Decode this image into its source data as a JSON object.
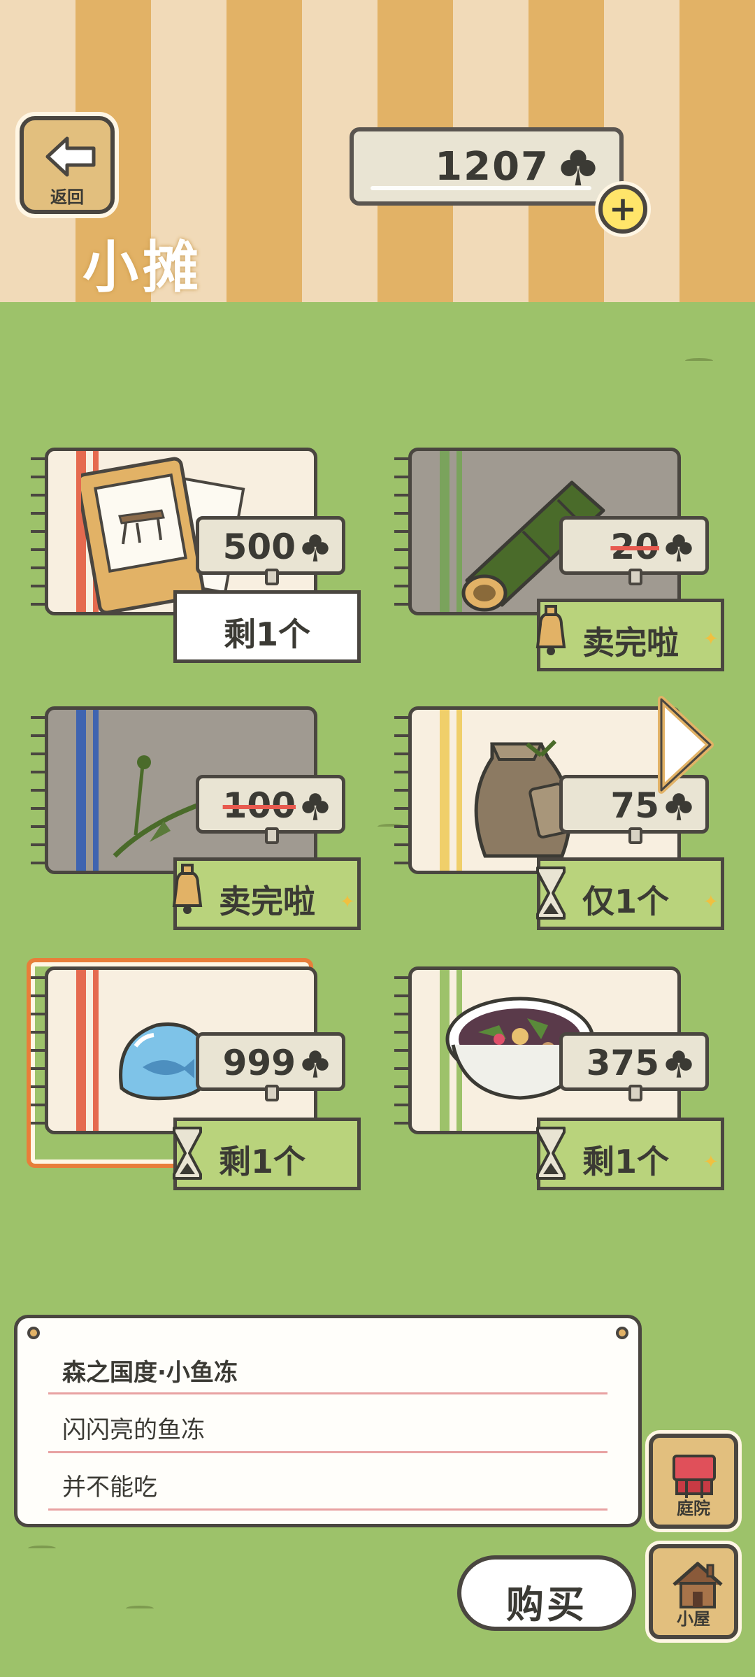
{
  "header": {
    "title": "小摊",
    "back_label": "返回",
    "currency_value": "1207",
    "currency_icon": "clover-icon",
    "plus_icon": "plus-icon"
  },
  "items": [
    {
      "name": "chair-poster",
      "price": "500",
      "price_struck": false,
      "status": "剩1个",
      "status_style": "white",
      "status_icon": ""
    },
    {
      "name": "bamboo",
      "price": "20",
      "price_struck": true,
      "status": "卖完啦",
      "status_style": "green",
      "status_icon": "bell-icon"
    },
    {
      "name": "dandelion",
      "price": "100",
      "price_struck": true,
      "status": "卖完啦",
      "status_style": "green",
      "status_icon": "bell-icon"
    },
    {
      "name": "seed-bag",
      "price": "75",
      "price_struck": false,
      "status": "仅1个",
      "status_style": "green",
      "status_icon": "hourglass-icon"
    },
    {
      "name": "fish-jelly",
      "price": "999",
      "price_struck": false,
      "status": "剩1个",
      "status_style": "green",
      "status_icon": "hourglass-icon"
    },
    {
      "name": "salad-bowl",
      "price": "375",
      "price_struck": false,
      "status": "剩1个",
      "status_style": "green",
      "status_icon": "hourglass-icon"
    }
  ],
  "description": {
    "title": "森之国度·小鱼冻",
    "line1": "闪闪亮的鱼冻",
    "line2": "并不能吃"
  },
  "buttons": {
    "yard_label": "庭院",
    "house_label": "小屋",
    "buy_label": "购买"
  },
  "colors": {
    "grass": "#9dc26a",
    "stripe_orange": "#e2b266",
    "stripe_cream": "#f1dab8",
    "status_green": "#b9d37c",
    "selected_frame": "#e87e3a",
    "strike_red": "#e85a4f"
  }
}
